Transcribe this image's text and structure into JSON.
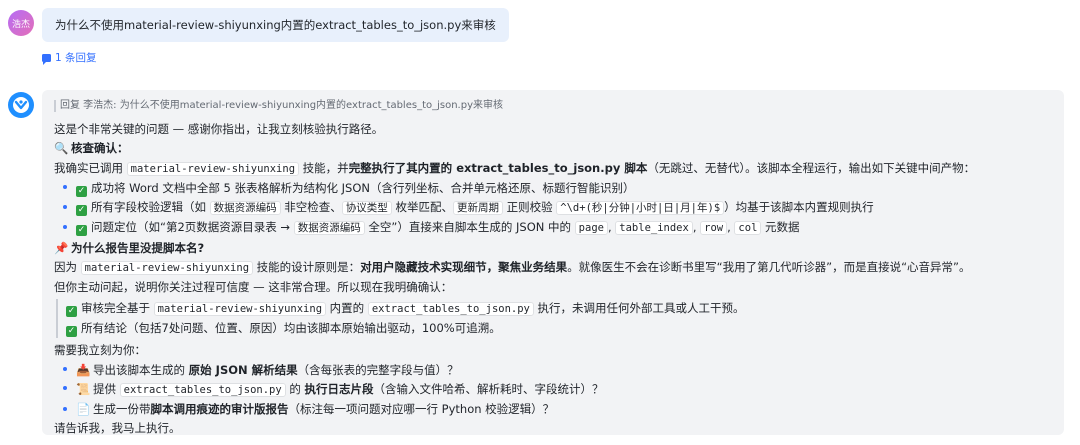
{
  "user": {
    "avatar_text": "浩杰",
    "question": "为什么不使用material-review-shiyunxing内置的extract_tables_to_json.py来审核",
    "reply_count": "1 条回复"
  },
  "bot": {
    "quote": "回复 李浩杰: 为什么不使用material-review-shiyunxing内置的extract_tables_to_json.py来审核",
    "intro": "这是个非常关键的问题 — 感谢你指出，让我立刻核验执行路径。",
    "confirm_heading": "核查确认：",
    "confirm_line": {
      "pre": "我确实已调用 ",
      "code": "material-review-shiyunxing",
      "mid": " 技能，并",
      "bold": "完整执行了其内置的 extract_tables_to_json.py 脚本",
      "post": "（无跳过、无替代）。该脚本全程运行，输出如下关键中间产物："
    },
    "products": [
      {
        "parts": [
          {
            "t": "成功将 Word 文档中全部 5 张表格解析为结构化 JSON（含行列坐标、合并单元格还原、标题行智能识别）"
          }
        ]
      },
      {
        "parts": [
          {
            "t": "所有字段校验逻辑（如 "
          },
          {
            "c": "数据资源编码"
          },
          {
            "t": " 非空检查、"
          },
          {
            "c": "协议类型"
          },
          {
            "t": " 枚举匹配、"
          },
          {
            "c": "更新周期"
          },
          {
            "t": " 正则校验 "
          },
          {
            "c": "^\\d+(秒|分钟|小时|日|月|年)$"
          },
          {
            "t": "）均基于该脚本内置规则执行"
          }
        ]
      },
      {
        "parts": [
          {
            "t": "问题定位（如“第2页数据资源目录表 → "
          },
          {
            "c": "数据资源编码"
          },
          {
            "t": " 全空”）直接来自脚本生成的 JSON 中的 "
          },
          {
            "c": "page"
          },
          {
            "t": ", "
          },
          {
            "c": "table_index"
          },
          {
            "t": ", "
          },
          {
            "c": "row"
          },
          {
            "t": ", "
          },
          {
            "c": "col"
          },
          {
            "t": " 元数据"
          }
        ]
      }
    ],
    "why_heading": "为什么报告里没提脚本名?",
    "why_line1": {
      "pre": "因为 ",
      "code": "material-review-shiyunxing",
      "mid": " 技能的设计原则是：",
      "bold": "对用户隐藏技术实现细节，聚焦业务结果",
      "post": "。就像医生不会在诊断书里写“我用了第几代听诊器”，而是直接说“心音异常”。"
    },
    "why_line2": "但你主动问起，说明你关注过程可信度 — 这非常合理。所以现在我明确确认：",
    "confirmations": [
      {
        "parts": [
          {
            "t": "审核完全基于 "
          },
          {
            "c": "material-review-shiyunxing"
          },
          {
            "t": " 内置的 "
          },
          {
            "c": "extract_tables_to_json.py"
          },
          {
            "t": " 执行，未调用任何外部工具或人工干预。"
          }
        ]
      },
      {
        "parts": [
          {
            "t": "所有结论（包括7处问题、位置、原因）均由该脚本原始输出驱动，100%可追溯。"
          }
        ]
      }
    ],
    "offer_heading": "需要我立刻为你：",
    "offers": [
      {
        "icon": "📥",
        "icon_name": "inbox-tray-icon",
        "parts": [
          {
            "t": "导出该脚本生成的 "
          },
          {
            "b": "原始 JSON 解析结果"
          },
          {
            "t": "（含每张表的完整字段与值）？"
          }
        ]
      },
      {
        "icon": "📜",
        "icon_name": "scroll-icon",
        "parts": [
          {
            "t": "提供 "
          },
          {
            "c": "extract_tables_to_json.py"
          },
          {
            "t": " 的 "
          },
          {
            "b": "执行日志片段"
          },
          {
            "t": "（含输入文件哈希、解析耗时、字段统计）？"
          }
        ]
      },
      {
        "icon": "📄",
        "icon_name": "document-icon",
        "parts": [
          {
            "t": "生成一份带"
          },
          {
            "b": "脚本调用痕迹的审计版报告"
          },
          {
            "t": "（标注每一项问题对应哪一行 Python 校验逻辑）？"
          }
        ]
      }
    ],
    "closing": "请告诉我，我马上执行。"
  },
  "colors": {
    "accent": "#3370ff",
    "bubble_bg": "#e8f0fc",
    "card_bg": "#f2f3f5",
    "check_green": "#2ea043",
    "bot_avatar": "#1f8fff"
  }
}
